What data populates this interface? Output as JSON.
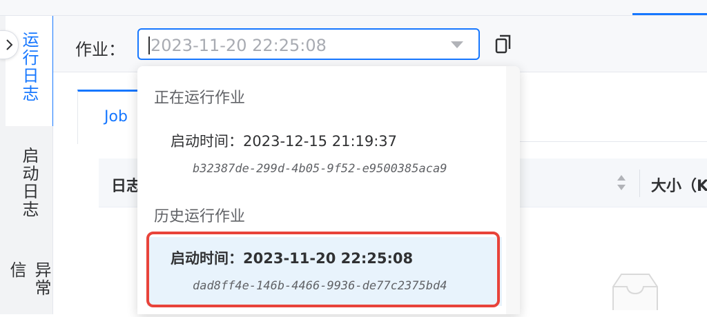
{
  "rail": {
    "tabs": [
      {
        "label": "运行日志",
        "active": true
      },
      {
        "label": "启动日志",
        "active": false
      },
      {
        "label": "异常信",
        "active": false
      }
    ]
  },
  "toolbar": {
    "job_label": "作业：",
    "select_value": "2023-11-20 22:25:08"
  },
  "content": {
    "tab_label": "Job",
    "columns": [
      "日志",
      "大小（K"
    ]
  },
  "dropdown": {
    "groups": [
      {
        "title": "正在运行作业",
        "options": [
          {
            "time": "启动时间：2023-12-15 21:19:37",
            "id": "b32387de-299d-4b05-9f52-e9500385aca9"
          }
        ]
      },
      {
        "title": "历史运行作业",
        "options": [
          {
            "time": "启动时间：2023-11-20 22:25:08",
            "id": "dad8ff4e-146b-4466-9936-de77c2375bd4",
            "selected": true
          }
        ]
      }
    ]
  },
  "colors": {
    "accent": "#1677ff",
    "highlight": "#e8433a",
    "selected_bg": "#e8f3fc"
  },
  "icons": [
    "chevron-right-icon",
    "dropdown-arrow-icon",
    "copy-icon",
    "sort-icon",
    "empty-box-icon"
  ]
}
